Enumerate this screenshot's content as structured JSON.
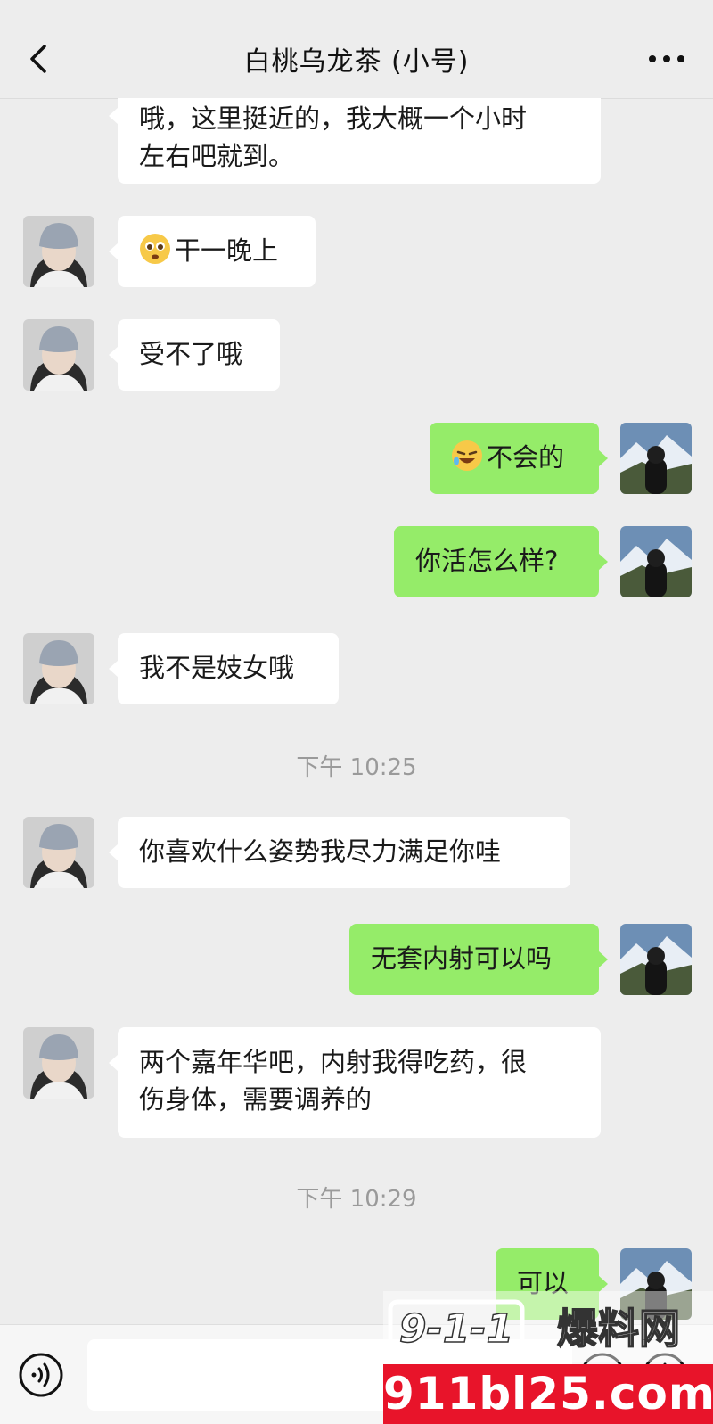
{
  "header": {
    "title": "白桃乌龙茶 (小号)",
    "back_icon": "chevron-left-icon",
    "more_icon": "more-dots-icon"
  },
  "messages": [
    {
      "side": "in",
      "text_line1": "哦，这里挺近的，我大概一个小时",
      "text_line2": "左右吧就到。"
    },
    {
      "side": "in",
      "emoji": "pleading-face-icon",
      "text": "干一晚上"
    },
    {
      "side": "in",
      "text": "受不了哦"
    },
    {
      "side": "out",
      "emoji": "rofl-face-icon",
      "text": "不会的"
    },
    {
      "side": "out",
      "text": "你活怎么样?"
    },
    {
      "side": "in",
      "text": "我不是妓女哦"
    },
    {
      "timestamp": "下午 10:25"
    },
    {
      "side": "in",
      "text": "你喜欢什么姿势我尽力满足你哇"
    },
    {
      "side": "out",
      "text": "无套内射可以吗"
    },
    {
      "side": "in",
      "text_line1": "两个嘉年华吧，内射我得吃药，很",
      "text_line2": "伤身体，需要调养的"
    },
    {
      "timestamp": "下午 10:29"
    },
    {
      "side": "out",
      "text": "可以"
    }
  ],
  "input_bar": {
    "voice_icon": "voice-icon",
    "emoji_icon": "emoji-icon",
    "plus_icon": "plus-icon"
  },
  "watermark": {
    "logo_text": "9-1-1爆料网",
    "url": "911bl25.com"
  },
  "colors": {
    "background": "#ededed",
    "incoming_bubble": "#ffffff",
    "outgoing_bubble": "#95ec69",
    "watermark_red": "#e8142a"
  }
}
